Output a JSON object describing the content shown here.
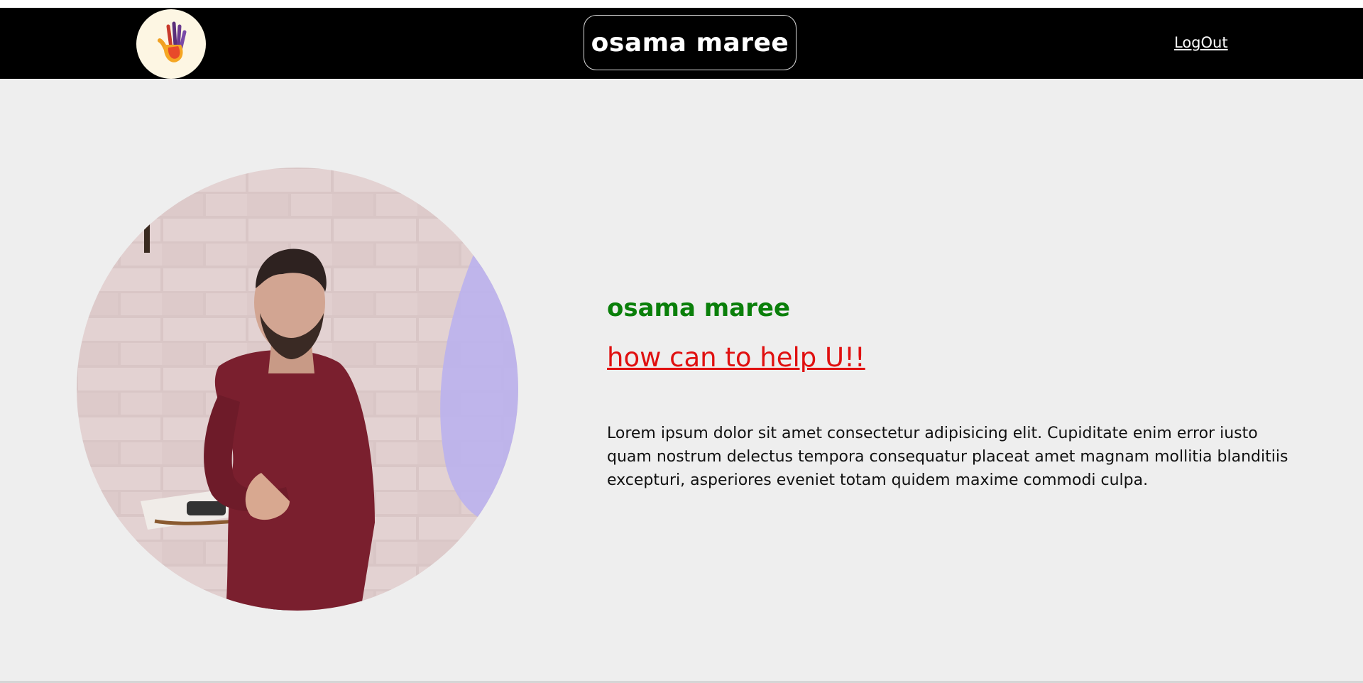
{
  "header": {
    "logo_icon": "hand-logo-icon",
    "brand_name": "osama maree",
    "logout_label": "LogOut"
  },
  "profile": {
    "photo_icon": "profile-photo",
    "name": "osama maree",
    "help_link": "how can to help U!!",
    "description": "Lorem ipsum dolor sit amet consectetur adipisicing elit. Cupiditate enim error iusto quam nostrum delectus tempora consequatur placeat amet magnam mollitia blanditiis excepturi, asperiores eveniet totam quidem maxime commodi culpa."
  },
  "colors": {
    "navbar": "#000000",
    "page_background": "#eeeeee",
    "name": "#0a7f0a",
    "help_link": "#e01010",
    "shirt": "#7a1f2e"
  }
}
